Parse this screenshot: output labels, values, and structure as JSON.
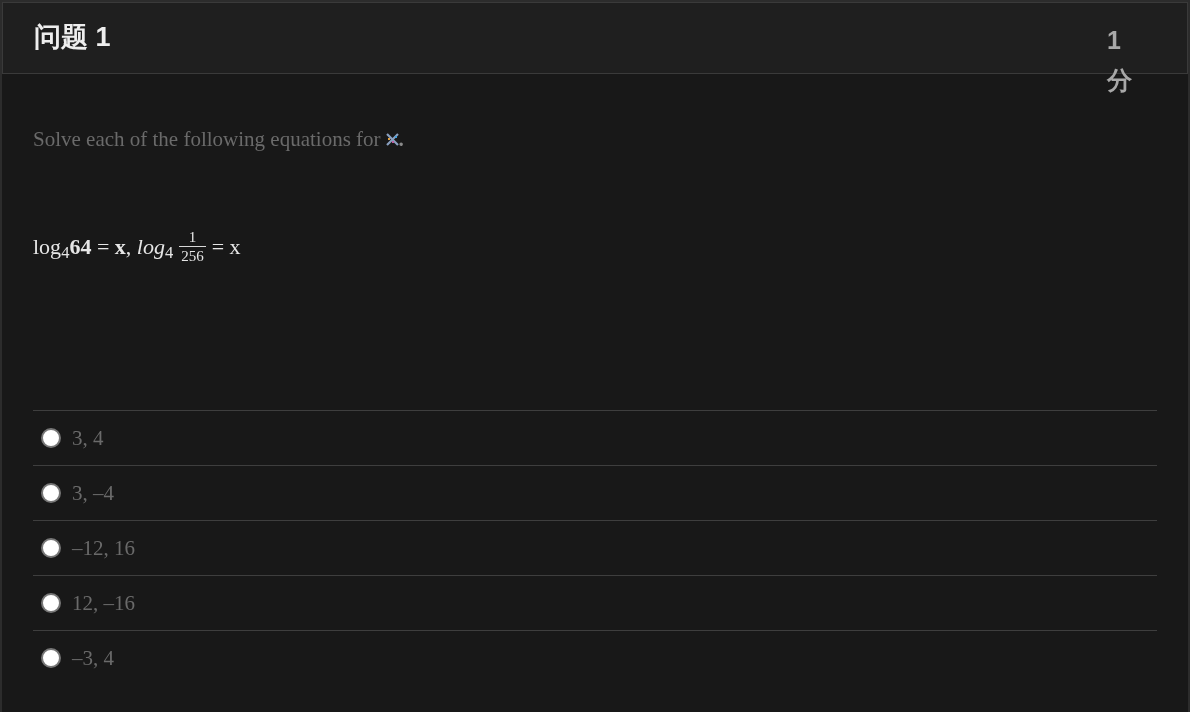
{
  "question": {
    "title": "问题 1",
    "points": "1 分",
    "prompt": {
      "text": "Solve each of the following equations for",
      "after_image": "."
    },
    "equation": [
      {
        "kind": "text",
        "text": "log$_{4}$**64** = **x**, *log*$_{4}$"
      },
      {
        "kind": "fraction",
        "numerator": "1",
        "denominator": "256"
      },
      {
        "kind": "text",
        "text": "= x"
      }
    ],
    "options": [
      {
        "label": "3, 4",
        "selected": false
      },
      {
        "label": "3, –4",
        "selected": false
      },
      {
        "label": "–12, 16",
        "selected": false
      },
      {
        "label": "12, –16",
        "selected": false
      },
      {
        "label": "–3, 4",
        "selected": false
      }
    ]
  }
}
